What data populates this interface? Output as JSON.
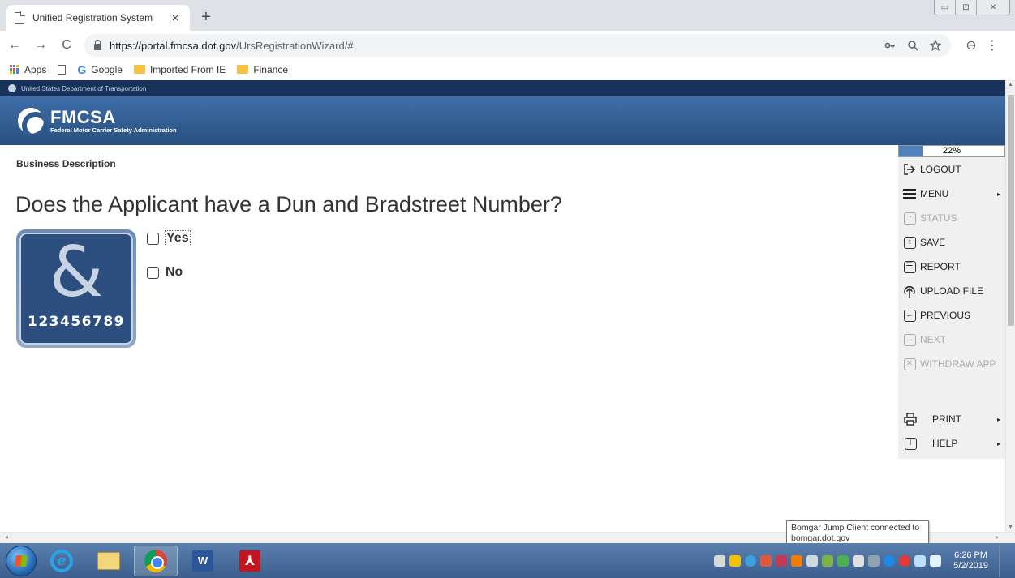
{
  "browser": {
    "tab_title": "Unified Registration System",
    "tab_close": "×",
    "new_tab": "+",
    "window_controls": [
      "▭",
      "⊡",
      "✕"
    ],
    "nav": {
      "back": "←",
      "forward": "→",
      "reload": "C"
    },
    "url_host": "https://portal.fmcsa.dot.gov",
    "url_path": "/UrsRegistrationWizard/#",
    "omnibox_icons": [
      "key-icon",
      "zoom-icon",
      "star-icon"
    ],
    "profile": "⊖",
    "menu": "⋮",
    "bookmarks": [
      {
        "label": "Apps",
        "icon": "apps-grid-icon"
      },
      {
        "label": "",
        "icon": "page-icon"
      },
      {
        "label": "Google",
        "icon": "google-icon"
      },
      {
        "label": "Imported From IE",
        "icon": "folder-icon"
      },
      {
        "label": "Finance",
        "icon": "folder-icon"
      }
    ]
  },
  "header": {
    "agency": "United States Department of Transportation",
    "logo_title": "FMCSA",
    "logo_subtitle": "Federal Motor Carrier Safety Administration"
  },
  "main": {
    "breadcrumb": "Business Description",
    "question": "Does the Applicant have a Dun and Bradstreet Number?",
    "duns_image_number": "123456789",
    "options": [
      {
        "label": "Yes",
        "checked": false
      },
      {
        "label": "No",
        "checked": false
      }
    ]
  },
  "side_panel": {
    "progress_percent": 22,
    "progress_label": "22%",
    "items": [
      {
        "label": "LOGOUT",
        "icon": "logout-icon",
        "disabled": false,
        "submenu": false
      },
      {
        "label": "MENU",
        "icon": "hamburger-icon",
        "disabled": false,
        "submenu": true
      },
      {
        "label": "STATUS",
        "icon": "status-icon",
        "disabled": true,
        "submenu": false
      },
      {
        "label": "SAVE",
        "icon": "save-icon",
        "disabled": false,
        "submenu": false
      },
      {
        "label": "REPORT",
        "icon": "report-icon",
        "disabled": false,
        "submenu": false
      },
      {
        "label": "UPLOAD FILE",
        "icon": "upload-icon",
        "disabled": false,
        "submenu": false
      },
      {
        "label": "PREVIOUS",
        "icon": "previous-icon",
        "disabled": false,
        "submenu": false
      },
      {
        "label": "NEXT",
        "icon": "next-icon",
        "disabled": true,
        "submenu": false
      },
      {
        "label": "WITHDRAW APP",
        "icon": "withdraw-icon",
        "disabled": true,
        "submenu": false
      }
    ],
    "bottom_items": [
      {
        "label": "PRINT",
        "icon": "printer-icon",
        "submenu": true
      },
      {
        "label": "HELP",
        "icon": "info-icon",
        "submenu": true
      }
    ]
  },
  "tooltip": {
    "line1": "Bomgar Jump Client connected to",
    "line2": "bomgar.dot.gov"
  },
  "taskbar": {
    "apps": [
      "internet-explorer-icon",
      "windows-explorer-icon",
      "chrome-icon",
      "word-icon",
      "acrobat-icon"
    ],
    "word_glyph": "W",
    "acrobat_glyph": "⅄",
    "time": "6:26 PM",
    "date": "5/2/2019"
  },
  "colors": {
    "gov_strip": "#17335c",
    "banner": "#3f6ea8",
    "progress_fill": "#4f81bd",
    "taskbar": "#4a6e9c"
  }
}
